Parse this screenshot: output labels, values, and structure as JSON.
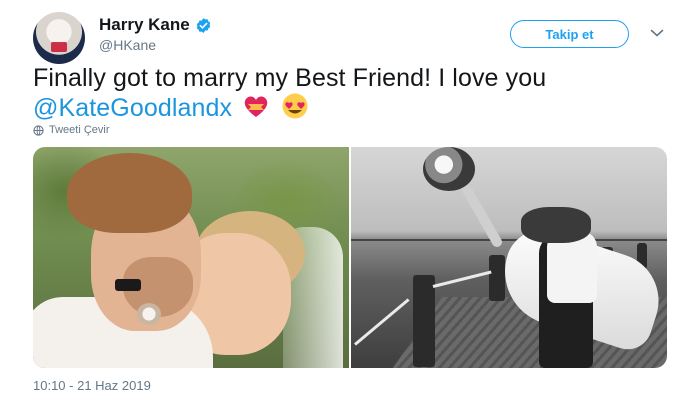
{
  "tweet": {
    "author_name": "Harry Kane",
    "author_handle": "@HKane",
    "verified": true,
    "follow_label": "Takip et",
    "text_main": "Finally got to marry my Best Friend! I love you ",
    "mention": "@KateGoodlandx",
    "emojis": [
      "heart-with-ribbon",
      "heart-eyes-face"
    ],
    "translate_label": "Tweeti Çevir",
    "timestamp": "10:10 - 21 Haz 2019",
    "media_count": 2
  },
  "colors": {
    "accent": "#1da1f2",
    "mention": "#1b95e0",
    "secondary_text": "#657786",
    "primary_text": "#14171a"
  },
  "icons": {
    "verified": "verified-badge-icon",
    "menu": "chevron-down-icon",
    "translate": "globe-icon"
  }
}
